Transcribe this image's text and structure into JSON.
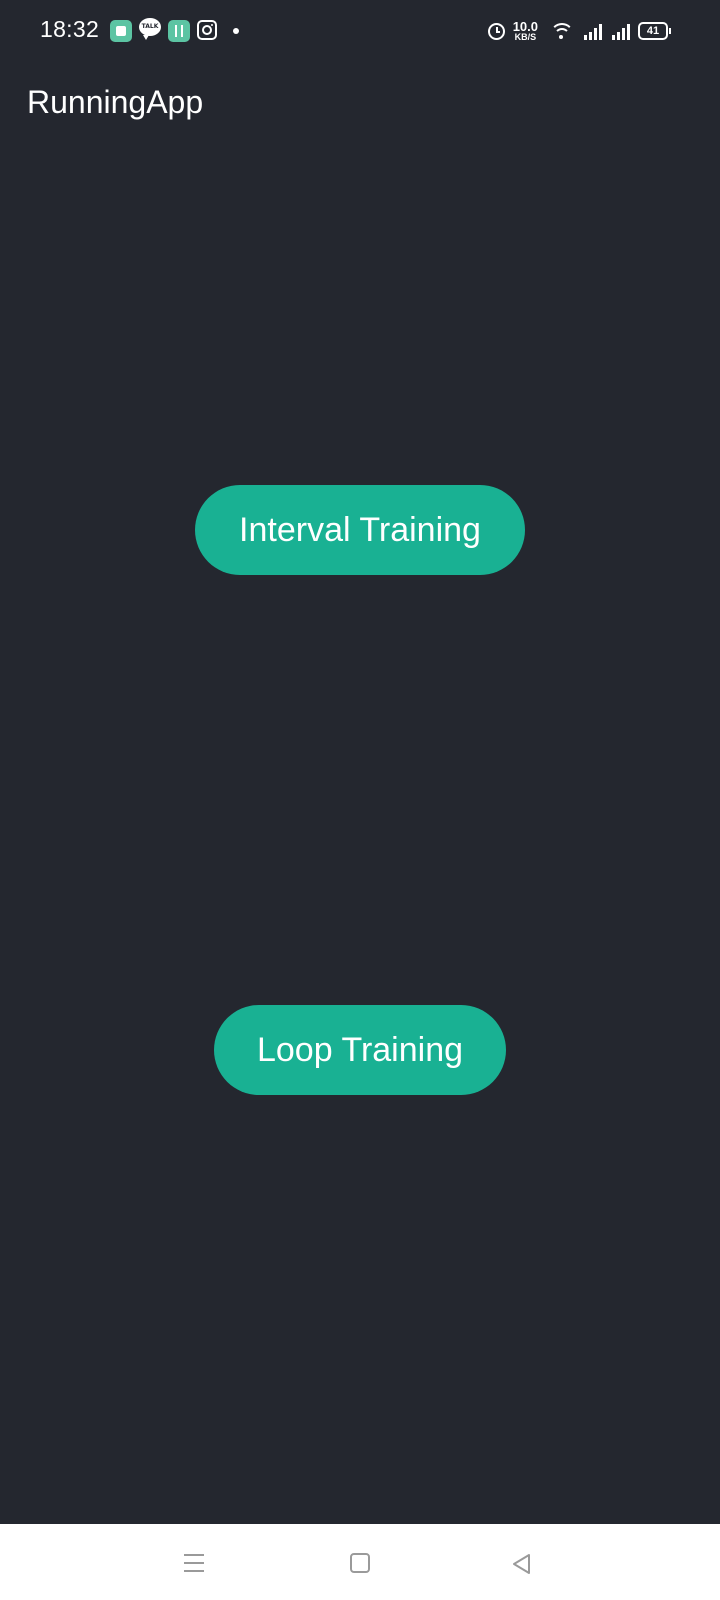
{
  "status_bar": {
    "time": "18:32",
    "notification_icons": [
      "app-icon",
      "kakaotalk-icon",
      "app-store-icon",
      "instagram-icon",
      "more-notifications-dot"
    ],
    "talk_label": "TALK",
    "net_speed_value": "10.0",
    "net_speed_unit": "KB/S",
    "battery_level": "41"
  },
  "app_bar": {
    "title": "RunningApp"
  },
  "main": {
    "interval_button_label": "Interval Training",
    "loop_button_label": "Loop Training"
  },
  "colors": {
    "background": "#24272f",
    "accent": "#19b193",
    "nav_background": "#ffffff"
  },
  "nav_bar": {
    "icons": [
      "menu-icon",
      "home-icon",
      "back-icon"
    ]
  }
}
